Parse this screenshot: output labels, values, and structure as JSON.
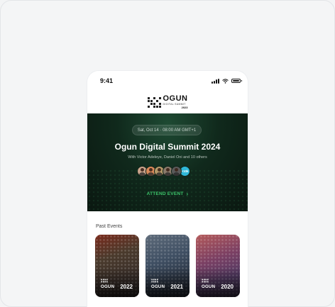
{
  "status_bar": {
    "time": "9:41"
  },
  "logo": {
    "name": "OGUN",
    "subtitle": "DIGITAL SUMMIT",
    "year": "2023"
  },
  "hero": {
    "date": "Sat, Oct 14 · 08:00 AM GMT+1",
    "title": "Ogun Digital Summit 2024",
    "subtitle": "With Victor Adeleye, Daniel Oni and 10 others",
    "avatars": [
      {
        "color": "#c9a38b"
      },
      {
        "color": "#d98a5a"
      },
      {
        "color": "#b59a6a"
      },
      {
        "color": "#8a7a6a"
      },
      {
        "color": "#5a5a5a"
      }
    ],
    "more_count": "+10k",
    "attend_label": "ATTEND EVENT",
    "accent_color": "#3cc46a"
  },
  "past_events": {
    "title": "Past Events",
    "items": [
      {
        "brand": "OGUN",
        "year": "2022"
      },
      {
        "brand": "OGUN",
        "year": "2021"
      },
      {
        "brand": "OGUN",
        "year": "2020"
      }
    ]
  }
}
